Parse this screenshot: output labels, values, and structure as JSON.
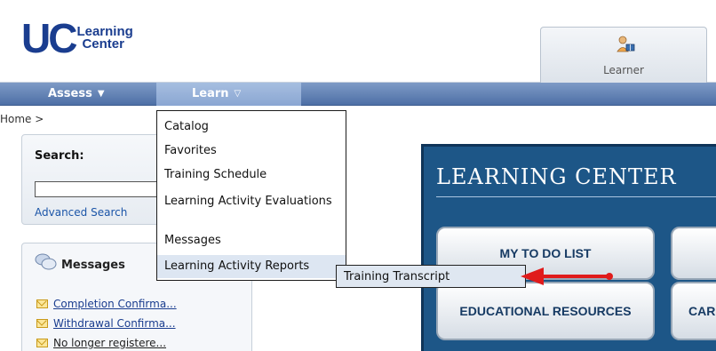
{
  "header": {
    "logo": {
      "uc": "UC",
      "line1": "Learning",
      "line2": "Center"
    },
    "role_tab": {
      "label": "Learner",
      "icon": "learner-icon"
    }
  },
  "nav": {
    "assess": "Assess",
    "learn": "Learn",
    "caret_icon": "chevron-down-icon"
  },
  "breadcrumb": "Home >",
  "search": {
    "label": "Search:",
    "value": "",
    "advanced": "Advanced Search",
    "separator": "|"
  },
  "messages": {
    "title": "Messages",
    "items": [
      "Completion Confirma...",
      "Withdrawal Confirma...",
      "No longer registere..."
    ]
  },
  "learn_menu": {
    "items": [
      "Catalog",
      "Favorites",
      "Training Schedule",
      "Learning Activity Evaluations",
      "Messages",
      "Learning Activity Reports"
    ],
    "submenu": [
      "Training Transcript"
    ]
  },
  "hero": {
    "title": "LEARNING CENTER",
    "buttons": {
      "todo": "MY TO DO LIST",
      "edu": "EDUCATIONAL RESOURCES",
      "side2": "CAR"
    }
  },
  "colors": {
    "nav_bg": "#4d6fa6",
    "hero_bg": "#1d5687",
    "arrow": "#e01b1b",
    "link": "#1a3d8f"
  }
}
